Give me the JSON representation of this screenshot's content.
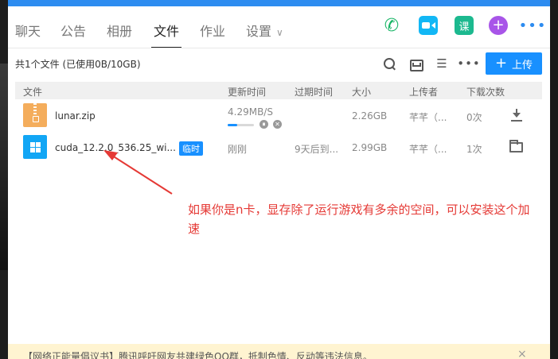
{
  "tabs": [
    {
      "label": "聊天"
    },
    {
      "label": "公告"
    },
    {
      "label": "相册"
    },
    {
      "label": "文件"
    },
    {
      "label": "作业"
    },
    {
      "label": "设置"
    }
  ],
  "active_tab": "文件",
  "header_icons": [
    "phone-icon",
    "video-call-icon",
    "course-icon",
    "plus-icon",
    "more-icon"
  ],
  "header_icon_glyphs": {
    "course": "课",
    "plus": "+",
    "more": "•••"
  },
  "toolbar": {
    "file_count": "共1个文件 (已使用0B/10GB)",
    "upload_label": "上传",
    "upload_plus": "+",
    "more_glyph": "•••",
    "list_glyph": "☰"
  },
  "columns": [
    "文件",
    "更新时间",
    "过期时间",
    "大小",
    "上传者",
    "下载次数"
  ],
  "files": [
    {
      "name": "lunar.zip",
      "icon": "zip-file-icon",
      "update_time": "4.29MB/S",
      "progress": 0.35,
      "expire_time": "",
      "size": "2.26GB",
      "uploader": "芊芊（...",
      "downloads": "0次",
      "action_icon": "download-icon"
    },
    {
      "name": "cuda_12.2.0_536.25_wi...",
      "icon": "windows-exe-icon",
      "tag": "临时",
      "update_time": "刚刚",
      "expire_time": "9天后到...",
      "size": "2.99GB",
      "uploader": "芊芊（...",
      "downloads": "1次",
      "action_icon": "folder-icon"
    }
  ],
  "controls": {
    "pause": "⏸",
    "cancel": "✕"
  },
  "annotation": "如果你是n卡，显存除了运行游戏有多余的空间，可以安装这个加速",
  "notice": {
    "text": "【网络正能量倡议书】腾讯呼吁网友共建绿色QQ群，抵制色情、反动等违法信息。",
    "close": "×"
  },
  "colors": {
    "accent": "#1890ff",
    "annotation": "#e53935",
    "notice_bg": "#fff4d1",
    "tab_bar_top": "#2d8cf0"
  }
}
